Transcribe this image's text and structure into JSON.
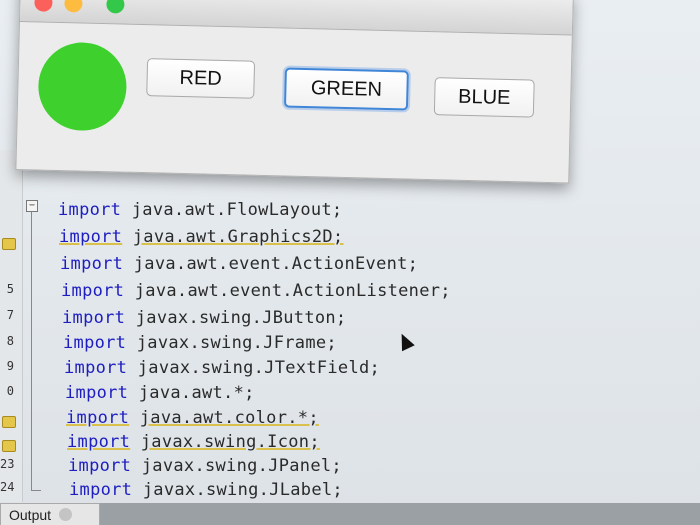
{
  "swing_window": {
    "traffic_colors": [
      "#fc605b",
      "#fdbc40",
      "#34c84a"
    ],
    "circle_color": "#3ed12e",
    "buttons": [
      {
        "label": "RED"
      },
      {
        "label": "GREEN",
        "focused": true
      },
      {
        "label": "BLUE"
      }
    ]
  },
  "editor": {
    "comment_fragment": "*/",
    "line_numbers": [
      "5",
      "7",
      "8",
      "9",
      "0",
      "23",
      "24"
    ],
    "code_lines": [
      {
        "keyword": "import",
        "rest": "java.awt.FlowLayout;"
      },
      {
        "keyword": "import",
        "rest": "java.awt.Graphics2D;"
      },
      {
        "keyword": "import",
        "rest": "java.awt.event.ActionEvent;"
      },
      {
        "keyword": "import",
        "rest": "java.awt.event.ActionListener;"
      },
      {
        "keyword": "import",
        "rest": "javax.swing.JButton;"
      },
      {
        "keyword": "import",
        "rest": "javax.swing.JFrame;"
      },
      {
        "keyword": "import",
        "rest": "javax.swing.JTextField;"
      },
      {
        "keyword": "import",
        "rest": "java.awt.*;"
      },
      {
        "keyword": "import",
        "rest": "java.awt.color.*;"
      },
      {
        "keyword": "import",
        "rest": "javax.swing.Icon;"
      },
      {
        "keyword": "import",
        "rest": "javax.swing.JPanel;"
      },
      {
        "keyword": "import",
        "rest": "javax.swing.JLabel;"
      }
    ]
  },
  "bottom_panel": {
    "output_tab_label": "Output"
  }
}
